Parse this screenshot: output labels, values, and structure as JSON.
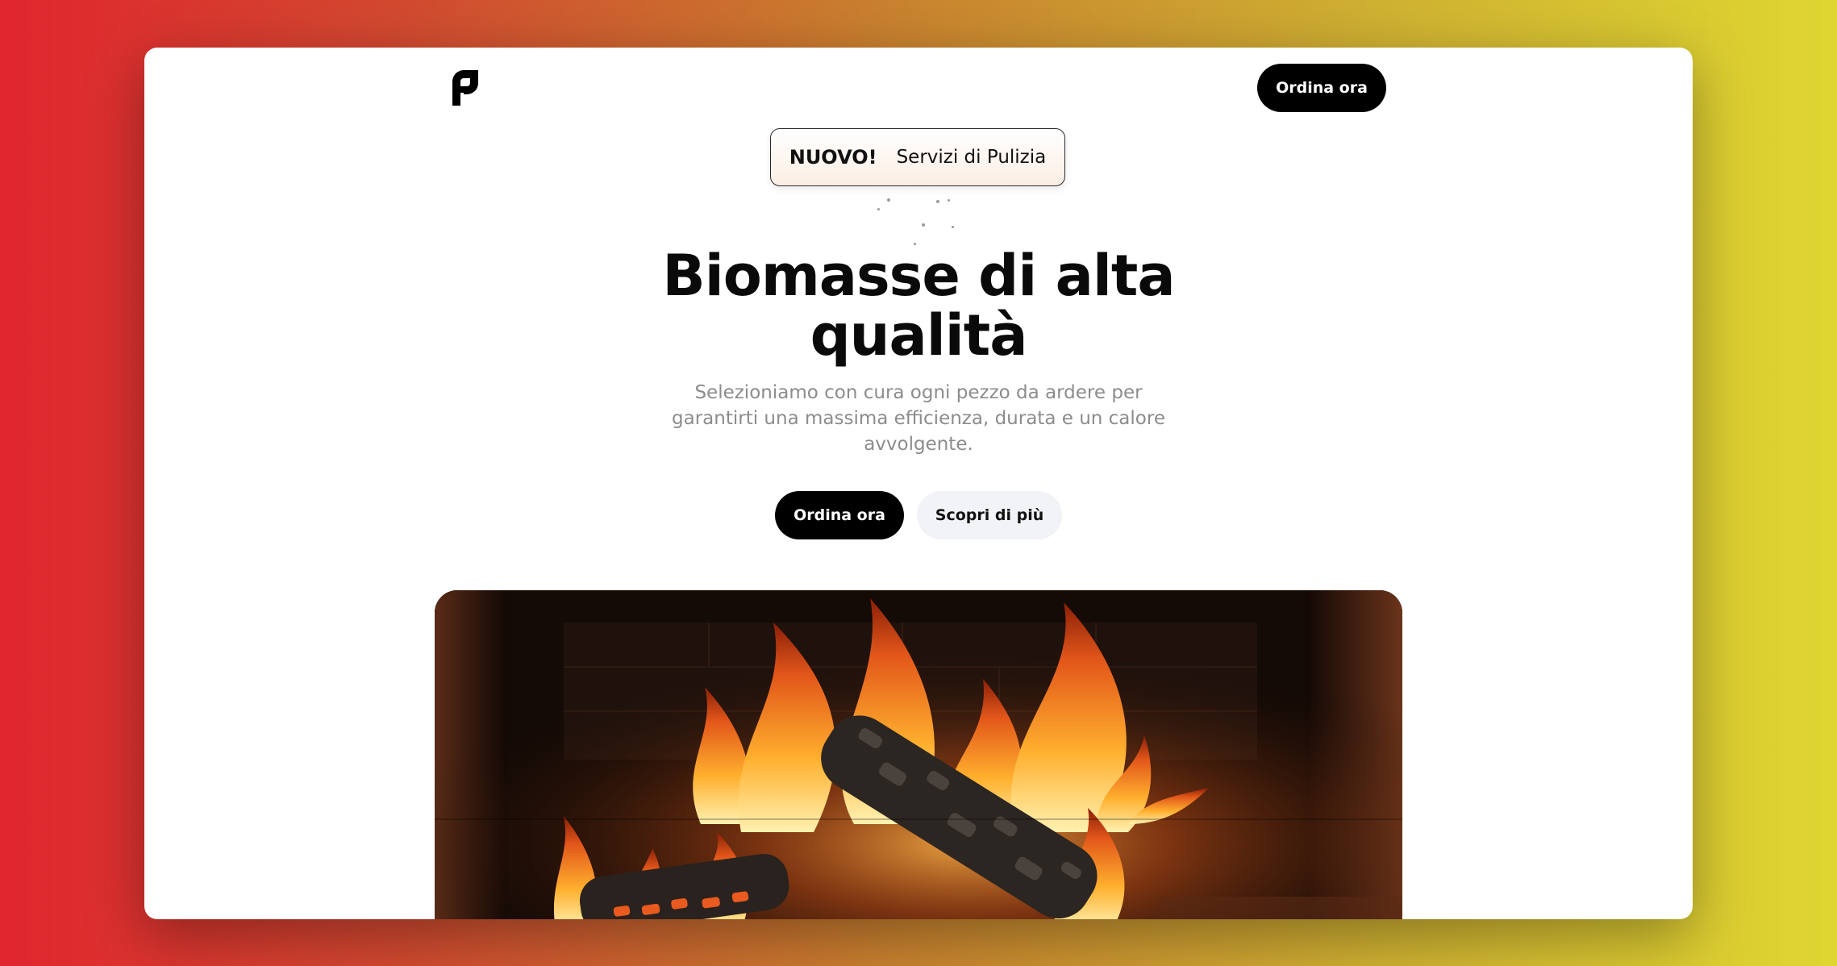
{
  "header": {
    "logo_icon": "brand-logo-icon",
    "cta_label": "Ordina ora"
  },
  "badge": {
    "strong": "NUOVO!",
    "text": "Servizi di Pulizia"
  },
  "hero": {
    "title": "Biomasse di alta qualità",
    "subtitle": "Selezioniamo con cura ogni pezzo da ardere per garantirti una massima efficienza, durata e un calore avvolgente.",
    "primary_label": "Ordina ora",
    "secondary_label": "Scopri di più"
  },
  "media": {
    "image": "fireplace-flames-video"
  },
  "colors": {
    "accent": "#000000",
    "secondary_button_bg": "#f1f3f6",
    "gradient_left": "#e0262e",
    "gradient_right": "#dfd631"
  }
}
